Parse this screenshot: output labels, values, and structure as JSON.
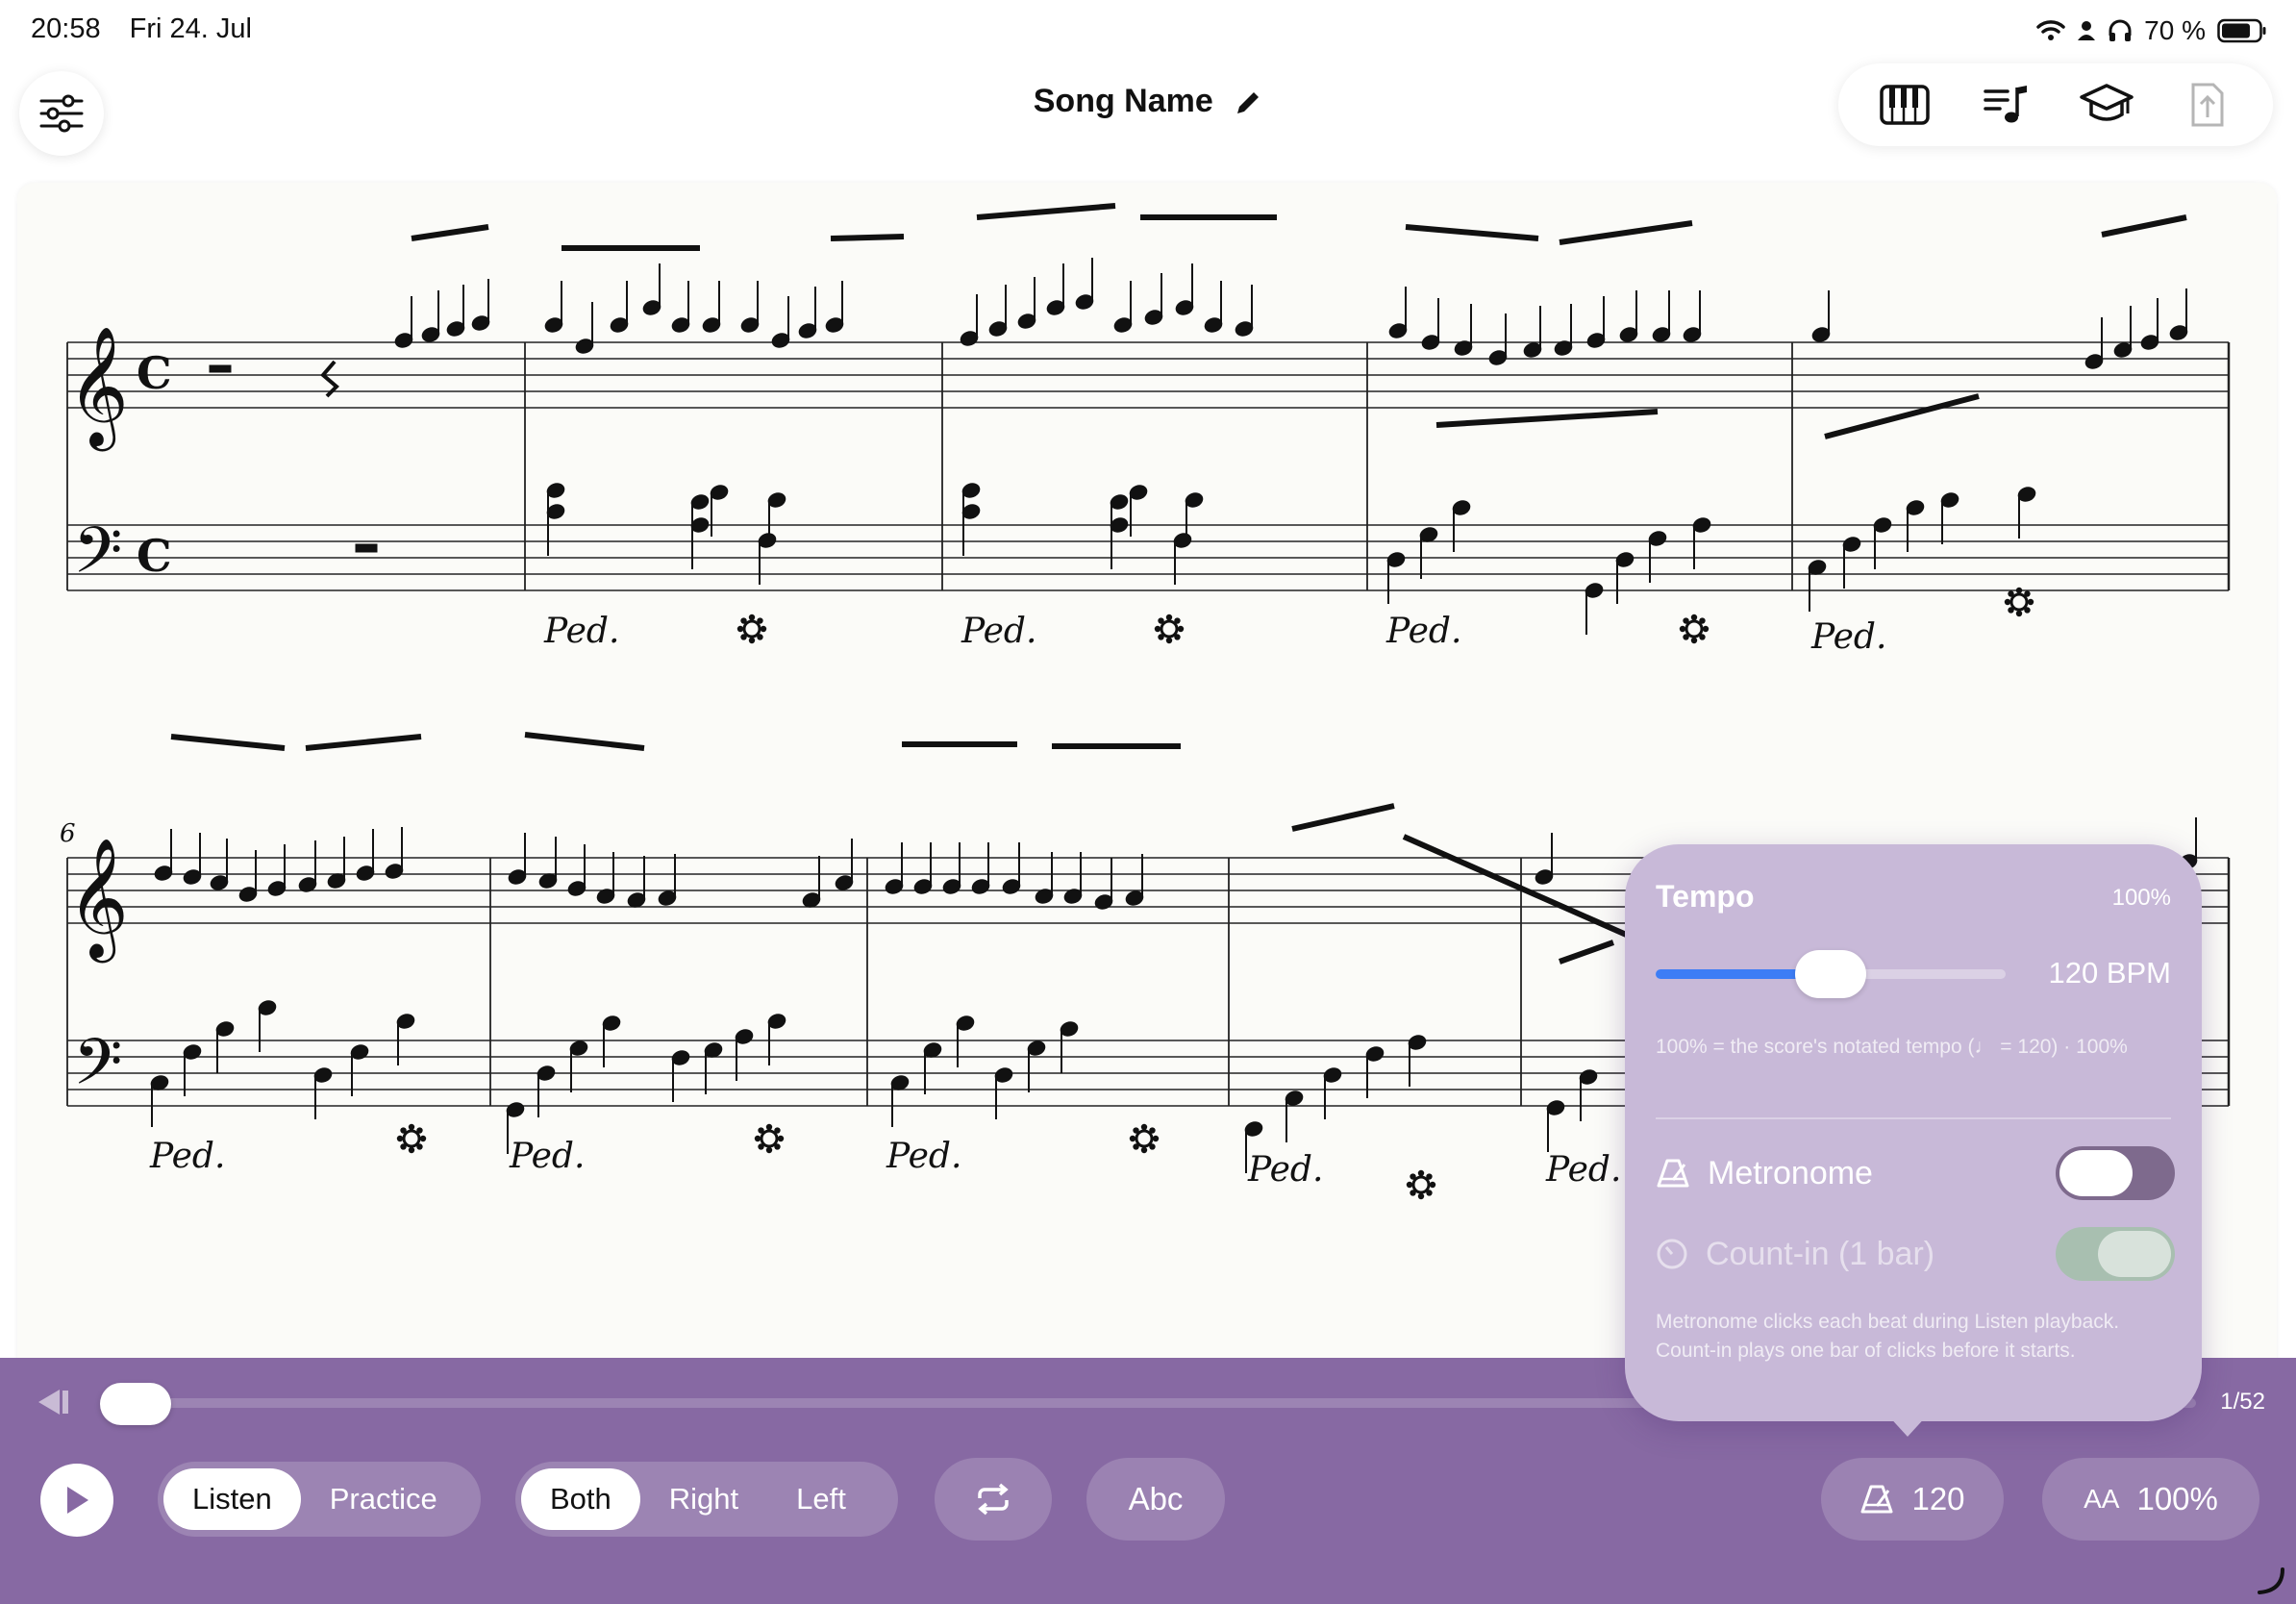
{
  "status_bar": {
    "time": "20:58",
    "date": "Fri 24. Jul",
    "battery": "70 %"
  },
  "header": {
    "song_name": "Song Name"
  },
  "score": {
    "measure_number": "6",
    "pedal_mark": "Ped."
  },
  "playback": {
    "page_count": "1/52",
    "progress": 0.0,
    "mode_options": [
      "Listen",
      "Practice"
    ],
    "mode_selected": "Listen",
    "hand_options": [
      "Both",
      "Right",
      "Left"
    ],
    "hand_selected": "Both",
    "notation_label": "Abc",
    "tempo_value": "120",
    "zoom_icon_label": "AA",
    "zoom_value": "100%"
  },
  "tempo_popover": {
    "title": "Tempo",
    "percent": "100%",
    "slider_fraction": 0.5,
    "bpm_label": "120 BPM",
    "note": "100% = the score's notated tempo (♩ = 120) · 100%",
    "metronome_label": "Metronome",
    "metronome_on": false,
    "countin_label": "Count-in (1 bar)",
    "countin_on": false,
    "footer": "Metronome clicks each beat during Listen playback. Count-in plays one bar of clicks before it starts."
  },
  "colors": {
    "accent_bar": "#8769a3",
    "popover": "#c8b9d8",
    "slider_fill": "#3d7df5"
  }
}
